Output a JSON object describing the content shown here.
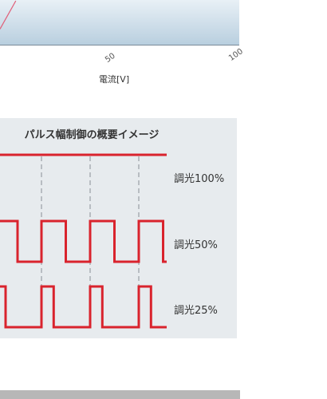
{
  "chart_data": {
    "type": "line",
    "x_ticks": [
      "50",
      "100"
    ],
    "xlabel": "電流[V]",
    "series": [
      {
        "x": [
          0,
          12
        ],
        "y": [
          0.35,
          0.98
        ]
      }
    ],
    "xlim": [
      0,
      100
    ]
  },
  "diagram": {
    "title": "パルス幅制御の概要イメージ",
    "line_color": "#d9232d",
    "guide_color": "#a8aeb3",
    "waves": [
      {
        "label": "調光100%",
        "duty": 1.0
      },
      {
        "label": "調光50%",
        "duty": 0.5
      },
      {
        "label": "調光25%",
        "duty": 0.25
      }
    ]
  }
}
